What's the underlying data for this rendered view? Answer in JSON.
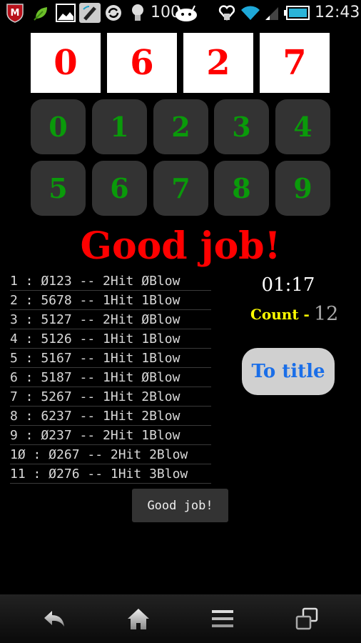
{
  "status_bar": {
    "icons": [
      "mcafee-icon",
      "leaf-icon",
      "gallery-icon",
      "usb-debug-icon",
      "sync-icon",
      "bulb-icon"
    ],
    "battery_level_text": "100",
    "right_icons": [
      "health-icon",
      "wifi-icon",
      "signal-icon",
      "battery-icon"
    ],
    "time": "12:43"
  },
  "answer": {
    "digits": [
      "0",
      "6",
      "2",
      "7"
    ]
  },
  "keypad": {
    "keys": [
      "0",
      "1",
      "2",
      "3",
      "4",
      "5",
      "6",
      "7",
      "8",
      "9"
    ]
  },
  "result_title": "Good job!",
  "history": [
    "1 : Ø123 -- 2Hit ØBlow",
    "2 : 5678 -- 1Hit 1Blow",
    "3 : 5127 -- 2Hit ØBlow",
    "4 : 5126 -- 1Hit 1Blow",
    "5 : 5167 -- 1Hit 1Blow",
    "6 : 5187 -- 1Hit ØBlow",
    "7 : 5267 -- 1Hit 2Blow",
    "8 : 6237 -- 1Hit 2Blow",
    "9 : Ø237 -- 2Hit 1Blow",
    "1Ø : Ø267 -- 2Hit 2Blow",
    "11 : Ø276 -- 1Hit 3Blow"
  ],
  "timer": "01:17",
  "count": {
    "label": "Count -",
    "value": "12"
  },
  "to_title_button": "To title",
  "toast": "Good job!",
  "nav_bar": [
    "back-icon",
    "home-icon",
    "menu-icon",
    "recent-apps-icon"
  ]
}
